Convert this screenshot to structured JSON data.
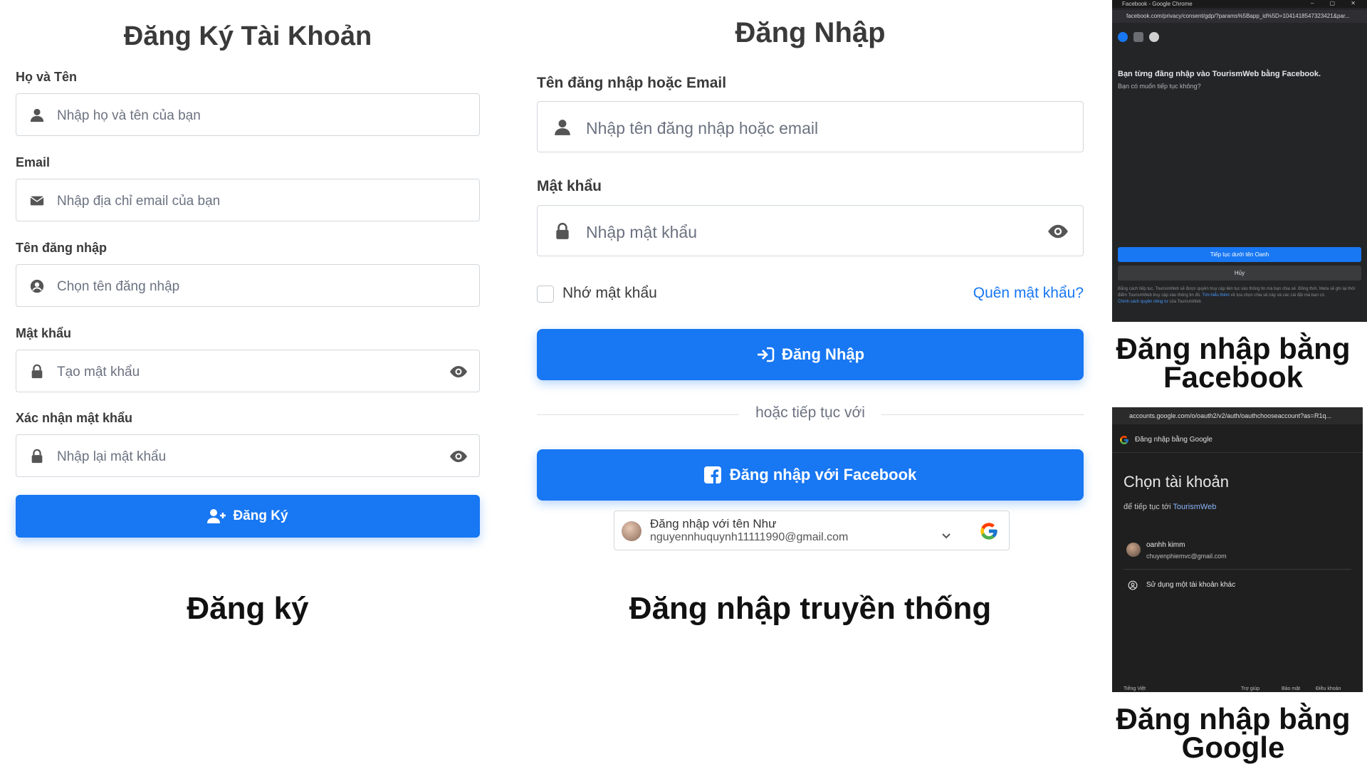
{
  "register": {
    "title": "Đăng Ký Tài Khoản",
    "fields": [
      {
        "label": "Họ và Tên",
        "placeholder": "Nhập họ và tên của bạn",
        "icon": "user-icon"
      },
      {
        "label": "Email",
        "placeholder": "Nhập địa chỉ email của bạn",
        "icon": "envelope-icon"
      },
      {
        "label": "Tên đăng nhập",
        "placeholder": "Chọn tên đăng nhập",
        "icon": "user-circle-icon"
      },
      {
        "label": "Mật khẩu",
        "placeholder": "Tạo mật khẩu",
        "icon": "lock-icon"
      },
      {
        "label": "Xác nhận mật khẩu",
        "placeholder": "Nhập lại mật khẩu",
        "icon": "lock-icon"
      }
    ],
    "submit_label": "Đăng Ký",
    "caption": "Đăng ký"
  },
  "login": {
    "title": "Đăng Nhập",
    "username_label": "Tên đăng nhập hoặc Email",
    "username_placeholder": "Nhập tên đăng nhập hoặc email",
    "password_label": "Mật khẩu",
    "password_placeholder": "Nhập mật khẩu",
    "remember_label": "Nhớ mật khẩu",
    "forgot_label": "Quên mật khẩu?",
    "login_button": "Đăng Nhập",
    "divider_text": "hoặc tiếp tục với",
    "facebook_button": "Đăng nhập với Facebook",
    "google_account_name": "Đăng nhập với tên Như",
    "google_account_email": "nguyennhuquynh11111990@gmail.com",
    "caption": "Đăng nhập truyền thống"
  },
  "facebook_shot": {
    "window_title": "Facebook - Google Chrome",
    "url": "facebook.com/privacy/consent/gdp/?params%5Bapp_id%5D=1041418547323421&par...",
    "heading": "Bạn từng đăng nhập vào TourismWeb bằng Facebook.",
    "subheading": "Bạn có muốn tiếp tục không?",
    "continue_button": "Tiếp tục dưới tên Oanh",
    "cancel_button": "Hủy",
    "fine_print": "Bằng cách tiếp tục, TourismWeb sẽ được quyền truy cập liên tục vào thông tin mà bạn chia sẻ. Đồng thời, Meta sẽ ghi lại thời điểm TourismWeb truy cập vào thông tin đó.",
    "learn_more": "Tìm hiểu thêm",
    "fine_print_2": "về lựa chọn chia sẻ này và các cài đặt mà bạn có.",
    "privacy_link": "Chính sách quyền riêng tư",
    "privacy_suffix": "của TourismWeb",
    "caption": "Đăng nhập bằng Facebook",
    "colors": {
      "bg": "#242526",
      "accent": "#1877f2"
    }
  },
  "google_shot": {
    "url": "accounts.google.com/o/oauth2/v2/auth/oauthchooseaccount?as=R1q...",
    "bar_title": "Đăng nhập bằng Google",
    "heading": "Chọn tài khoản",
    "sub_prefix": "để tiếp tục tới",
    "sub_app": "TourismWeb",
    "account_name": "oanhh kimm",
    "account_email": "chuyenphiemvc@gmail.com",
    "other_account": "Sử dụng một tài khoản khác",
    "footer_lang": "Tiếng Việt",
    "footer_help": "Trợ giúp",
    "footer_privacy": "Bảo mật",
    "footer_terms": "Điều khoản",
    "caption": "Đăng nhập bằng Google"
  }
}
